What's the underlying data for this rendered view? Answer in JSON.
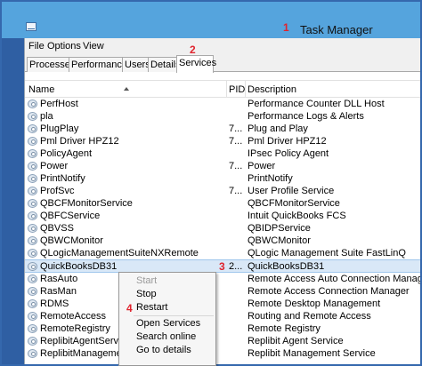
{
  "window": {
    "title": "Task Manager"
  },
  "markers": [
    "1",
    "2",
    "3",
    "4"
  ],
  "menu": [
    "File",
    "Options",
    "View"
  ],
  "tabs": [
    "Processes",
    "Performance",
    "Users",
    "Details",
    "Services"
  ],
  "columns": {
    "name": "Name",
    "pid": "PID",
    "desc": "Description"
  },
  "rows": [
    {
      "name": "PerfHost",
      "pid": "",
      "desc": "Performance Counter DLL Host"
    },
    {
      "name": "pla",
      "pid": "",
      "desc": "Performance Logs & Alerts"
    },
    {
      "name": "PlugPlay",
      "pid": "7...",
      "desc": "Plug and Play"
    },
    {
      "name": "Pml Driver HPZ12",
      "pid": "7...",
      "desc": "Pml Driver HPZ12"
    },
    {
      "name": "PolicyAgent",
      "pid": "",
      "desc": "IPsec Policy Agent"
    },
    {
      "name": "Power",
      "pid": "7...",
      "desc": "Power"
    },
    {
      "name": "PrintNotify",
      "pid": "",
      "desc": "PrintNotify"
    },
    {
      "name": "ProfSvc",
      "pid": "7...",
      "desc": "User Profile Service"
    },
    {
      "name": "QBCFMonitorService",
      "pid": "",
      "desc": "QBCFMonitorService"
    },
    {
      "name": "QBFCService",
      "pid": "",
      "desc": "Intuit QuickBooks FCS"
    },
    {
      "name": "QBVSS",
      "pid": "",
      "desc": "QBIDPService"
    },
    {
      "name": "QBWCMonitor",
      "pid": "",
      "desc": "QBWCMonitor"
    },
    {
      "name": "QLogicManagementSuiteNXRemote",
      "pid": "",
      "desc": "QLogic Management Suite FastLinQ"
    },
    {
      "name": "QuickBooksDB31",
      "pid": "2...",
      "desc": "QuickBooksDB31"
    },
    {
      "name": "RasAuto",
      "pid": "",
      "desc": "Remote Access Auto Connection Manager"
    },
    {
      "name": "RasMan",
      "pid": "",
      "desc": "Remote Access Connection Manager"
    },
    {
      "name": "RDMS",
      "pid": "",
      "desc": "Remote Desktop Management"
    },
    {
      "name": "RemoteAccess",
      "pid": "",
      "desc": "Routing and Remote Access"
    },
    {
      "name": "RemoteRegistry",
      "pid": "",
      "desc": "Remote Registry"
    },
    {
      "name": "ReplibitAgentService",
      "pid": "",
      "desc": "Replibit Agent Service"
    },
    {
      "name": "ReplibitManagementService",
      "pid": "",
      "desc": "Replibit Management Service"
    }
  ],
  "context_menu": {
    "start": "Start",
    "stop": "Stop",
    "restart": "Restart",
    "open_services": "Open Services",
    "search_online": "Search online",
    "go_to_details": "Go to details"
  }
}
